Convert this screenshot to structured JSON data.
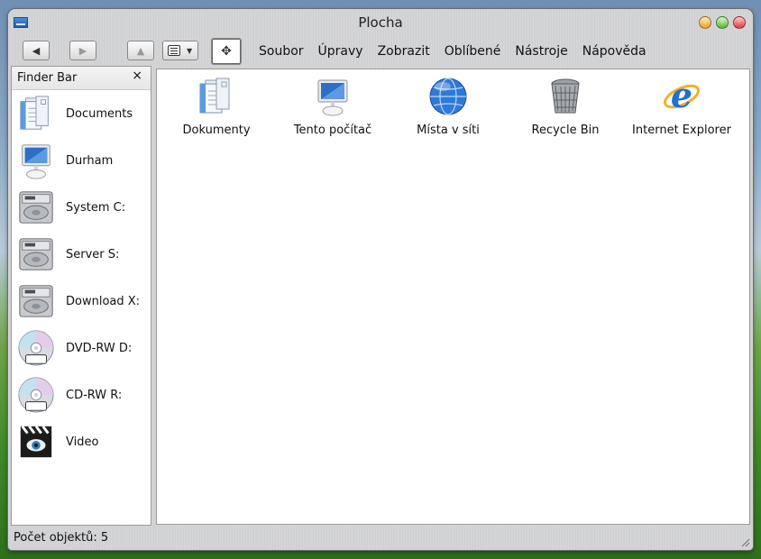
{
  "window": {
    "title": "Plocha"
  },
  "toolbar": {
    "back_label": "◀",
    "forward_label": "▶",
    "up_label": "▲",
    "active_label": "✥"
  },
  "menu": {
    "items": [
      "Soubor",
      "Úpravy",
      "Zobrazit",
      "Oblíbené",
      "Nástroje",
      "Nápověda"
    ]
  },
  "sidebar": {
    "title": "Finder Bar",
    "close_label": "×",
    "items": [
      {
        "label": "Documents",
        "icon": "documents-icon"
      },
      {
        "label": "Durham",
        "icon": "computer-icon"
      },
      {
        "label": "System C:",
        "icon": "hard-drive-icon"
      },
      {
        "label": "Server S:",
        "icon": "hard-drive-icon"
      },
      {
        "label": "Download X:",
        "icon": "hard-drive-icon"
      },
      {
        "label": "DVD-RW D:",
        "icon": "dvd-icon"
      },
      {
        "label": "CD-RW R:",
        "icon": "cd-icon"
      },
      {
        "label": "Video",
        "icon": "video-icon"
      }
    ]
  },
  "desktop": {
    "items": [
      {
        "label": "Dokumenty",
        "icon": "documents-icon"
      },
      {
        "label": "Tento počítač",
        "icon": "computer-icon"
      },
      {
        "label": "Místa v síti",
        "icon": "network-globe-icon"
      },
      {
        "label": "Recycle Bin",
        "icon": "trash-icon"
      },
      {
        "label": "Internet Explorer",
        "icon": "internet-explorer-icon"
      }
    ]
  },
  "status": {
    "text": "Počet objektů: 5"
  },
  "colors": {
    "window_chrome": "#d4d5d7",
    "close": "#d11a1a",
    "minimize": "#e38a00",
    "maximize": "#3fa11d",
    "ie_blue": "#1f6fd6"
  }
}
